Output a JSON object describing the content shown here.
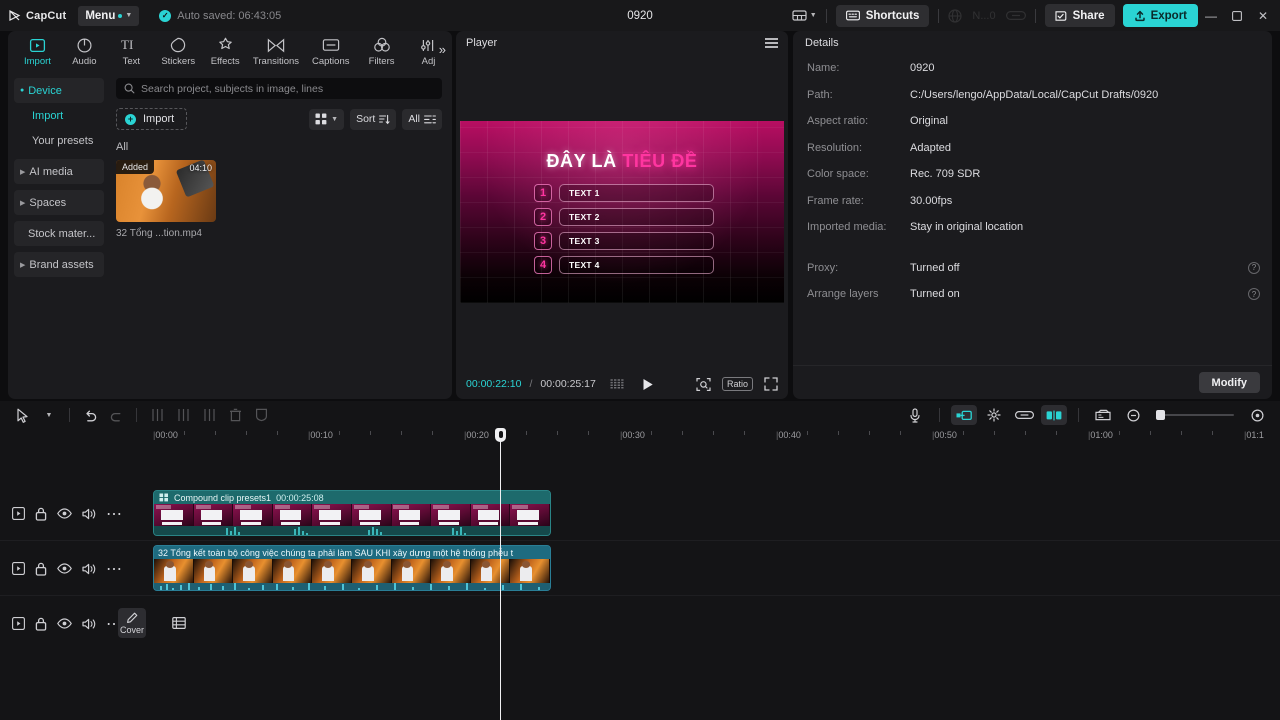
{
  "titlebar": {
    "brand": "CapCut",
    "menu_label": "Menu",
    "autosave": "Auto saved: 06:43:05",
    "project_title": "0920",
    "shortcuts_label": "Shortcuts",
    "dimmed_label": "N...0",
    "share_label": "Share",
    "export_label": "Export",
    "accent_color": "#2ad4d4"
  },
  "nav_tabs": [
    {
      "label": "Import",
      "icon": "import-icon",
      "active": true
    },
    {
      "label": "Audio",
      "icon": "audio-icon",
      "active": false
    },
    {
      "label": "Text",
      "icon": "text-icon",
      "active": false
    },
    {
      "label": "Stickers",
      "icon": "stickers-icon",
      "active": false
    },
    {
      "label": "Effects",
      "icon": "effects-icon",
      "active": false
    },
    {
      "label": "Transitions",
      "icon": "transitions-icon",
      "active": false
    },
    {
      "label": "Captions",
      "icon": "captions-icon",
      "active": false
    },
    {
      "label": "Filters",
      "icon": "filters-icon",
      "active": false
    },
    {
      "label": "Adj",
      "icon": "adjustment-icon",
      "active": false
    }
  ],
  "sidebar": {
    "items": [
      {
        "label": "Device",
        "type": "group-selected"
      },
      {
        "label": "Import",
        "type": "sub-active"
      },
      {
        "label": "Your presets",
        "type": "sub"
      },
      {
        "label": "AI media",
        "type": "group"
      },
      {
        "label": "Spaces",
        "type": "group"
      },
      {
        "label": "Stock mater...",
        "type": "group-plain"
      },
      {
        "label": "Brand assets",
        "type": "group"
      }
    ]
  },
  "media": {
    "search_placeholder": "Search project, subjects in image, lines",
    "import_label": "Import",
    "sort_label": "Sort",
    "filter_label": "All",
    "group_label": "All",
    "items": [
      {
        "name": "32 Tổng ...tion.mp4",
        "badge": "Added",
        "duration": "04:10"
      }
    ]
  },
  "player": {
    "title": "Player",
    "current_time": "00:00:22:10",
    "total_time": "00:00:25:17",
    "ratio_label": "Ratio",
    "canvas": {
      "title_white": "ĐÂY LÀ ",
      "title_pink": "TIÊU ĐỀ",
      "rows": [
        {
          "num": "1",
          "text": "TEXT 1"
        },
        {
          "num": "2",
          "text": "TEXT 2"
        },
        {
          "num": "3",
          "text": "TEXT 3"
        },
        {
          "num": "4",
          "text": "TEXT 4"
        }
      ]
    }
  },
  "details": {
    "title": "Details",
    "rows": [
      {
        "label": "Name:",
        "value": "0920",
        "help": false
      },
      {
        "label": "Path:",
        "value": "C:/Users/lengo/AppData/Local/CapCut Drafts/0920",
        "help": false
      },
      {
        "label": "Aspect ratio:",
        "value": "Original",
        "help": false
      },
      {
        "label": "Resolution:",
        "value": "Adapted",
        "help": false
      },
      {
        "label": "Color space:",
        "value": "Rec. 709 SDR",
        "help": false
      },
      {
        "label": "Frame rate:",
        "value": "30.00fps",
        "help": false
      },
      {
        "label": "Imported media:",
        "value": "Stay in original location",
        "help": false
      }
    ],
    "rows2": [
      {
        "label": "Proxy:",
        "value": "Turned off",
        "help": true
      },
      {
        "label": "Arrange layers",
        "value": "Turned on",
        "help": true
      }
    ],
    "modify_label": "Modify"
  },
  "timeline": {
    "ruler_ticks": [
      "00:00",
      "00:10",
      "00:20",
      "00:30",
      "00:40",
      "00:50",
      "01:00",
      "01:1"
    ],
    "cover_label": "Cover",
    "playhead_time": "00:00:22:10",
    "clips": [
      {
        "track": 1,
        "name": "Compound clip presets1",
        "duration": "00:00:25:08",
        "type": "compound"
      },
      {
        "track": 2,
        "name": "32 Tổng kết toàn bộ công việc chúng ta phải làm SAU KHI xây dựng một hệ thống phễu t",
        "type": "video"
      }
    ]
  }
}
